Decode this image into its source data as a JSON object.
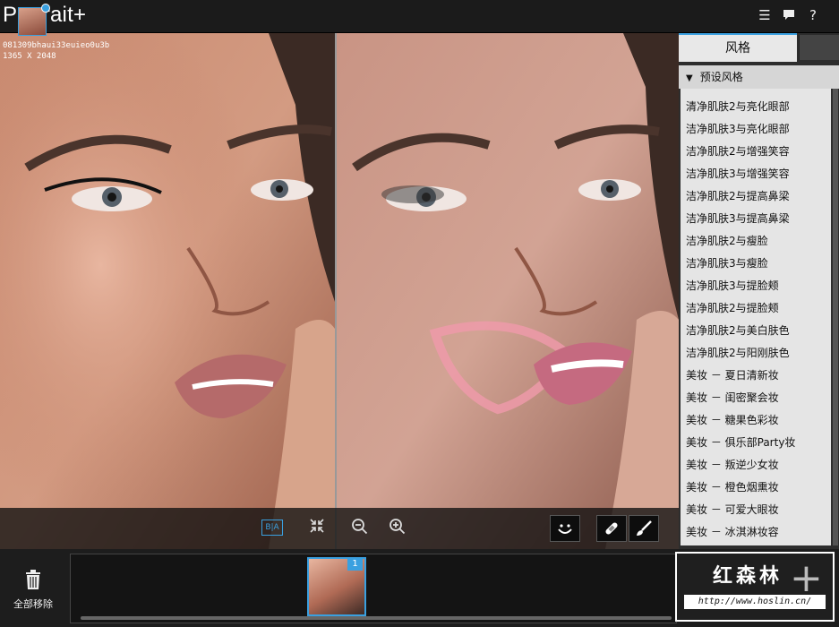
{
  "app": {
    "title": "Portrait+"
  },
  "titlebar": {
    "icons": [
      "list-icon",
      "chat-icon",
      "help-icon"
    ],
    "help_glyph": "?"
  },
  "image": {
    "filename": "081309bhaui33euieo0u3b",
    "dimensions": "1365 X 2048"
  },
  "toolbar": {
    "before_after_label": "B|A",
    "icons": [
      "thumbnail",
      "before-after-icon",
      "fit-icon",
      "zoom-out-icon",
      "zoom-in-icon",
      "smile-icon",
      "bandage-icon",
      "brush-icon"
    ]
  },
  "panel": {
    "tab_label": "风格",
    "section_title": "预设风格",
    "items": [
      "清净肌肤2与亮化眼部",
      "洁净肌肤3与亮化眼部",
      "洁净肌肤2与增强笑容",
      "洁净肌肤3与增强笑容",
      "洁净肌肤2与提高鼻梁",
      "洁净肌肤3与提高鼻梁",
      "洁净肌肤2与瘦脸",
      "洁净肌肤3与瘦脸",
      "洁净肌肤3与提脸颊",
      "洁净肌肤2与提脸颊",
      "洁净肌肤2与美白肤色",
      "洁净肌肤2与阳刚肤色",
      "美妆 － 夏日清新妆",
      "美妆 － 闺密聚会妆",
      "美妆 － 糖果色彩妆",
      "美妆 － 俱乐部Party妆",
      "美妆 － 叛逆少女妆",
      "美妆 － 橙色烟熏妆",
      "美妆 － 可爱大眼妆",
      "美妆 － 冰淇淋妆容"
    ]
  },
  "bottom": {
    "remove_all_label": "全部移除",
    "film_count": "1",
    "add_glyph": "+"
  },
  "watermark": {
    "text": "红森林",
    "url": "http://www.hoslin.cn/"
  },
  "colors": {
    "accent": "#3aa0e0",
    "panel_bg": "#e5e5e5",
    "dark": "#1a1a1a"
  }
}
